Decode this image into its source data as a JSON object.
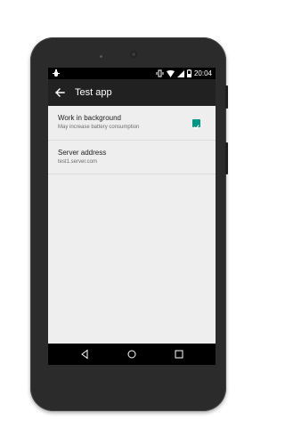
{
  "status_bar": {
    "time": "20:04",
    "icons": [
      "bug-icon",
      "vibrate-icon",
      "wifi-icon",
      "signal-icon",
      "battery-icon"
    ]
  },
  "app_bar": {
    "title": "Test app",
    "nav_icon": "back-arrow-icon"
  },
  "preferences": [
    {
      "title": "Work in background",
      "summary": "May increase battery consumption",
      "checked": true
    },
    {
      "title": "Server address",
      "summary": "test1.server.com"
    }
  ],
  "nav_bar": {
    "icons": [
      "back-icon",
      "home-icon",
      "recents-icon"
    ]
  },
  "colors": {
    "accent": "#009688",
    "app_bar": "#212121",
    "status_bar": "#000000",
    "background": "#eeeeee"
  }
}
